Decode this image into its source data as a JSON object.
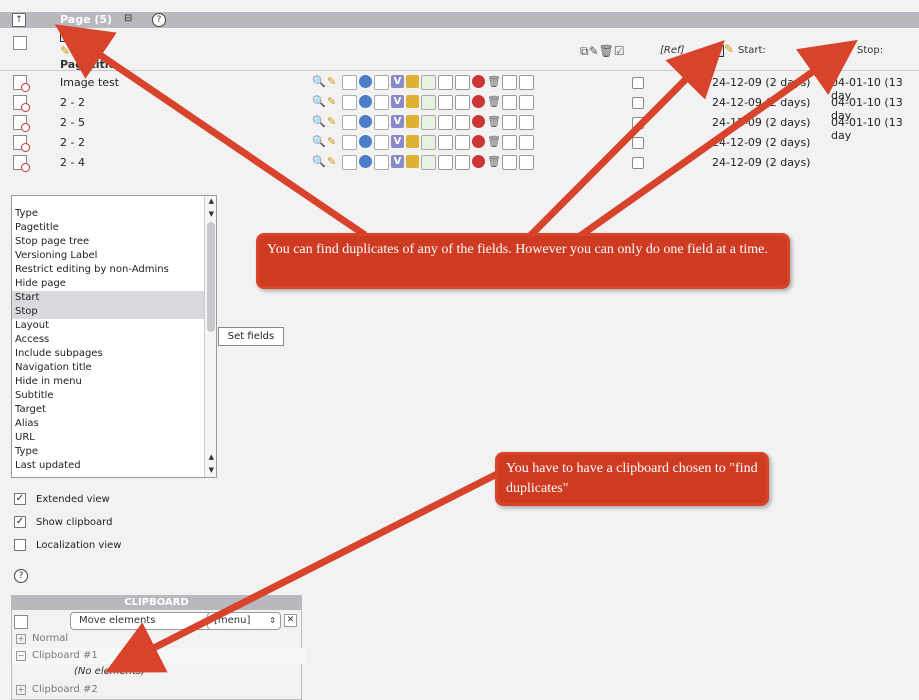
{
  "header": {
    "title": "Page (5)",
    "up_icon": "up-icon",
    "collapse_icon": "collapse-icon",
    "help": "?"
  },
  "columns": {
    "pagetitle": "Pagetitle",
    "ref": "[Ref]",
    "start": "Start:",
    "stop": "Stop:"
  },
  "rows": [
    {
      "title": "Image test",
      "start": "24-12-09 (2 days)",
      "stop": "04-01-10 (13 day"
    },
    {
      "title": "2 - 2",
      "start": "24-12-09 (2 days)",
      "stop": "04-01-10 (13 day"
    },
    {
      "title": "2 - 5",
      "start": "24-12-09 (2 days)",
      "stop": "04-01-10 (13 day"
    },
    {
      "title": "2 - 2",
      "start": "24-12-09 (2 days)",
      "stop": ""
    },
    {
      "title": "2 - 4",
      "start": "24-12-09 (2 days)",
      "stop": ""
    }
  ],
  "fields_list": [
    "Type",
    "Pagetitle",
    "Stop page tree",
    "Versioning Label",
    "Restrict editing by non-Admins",
    "Hide page",
    "Start",
    "Stop",
    "Layout",
    "Access",
    "Include subpages",
    "Navigation title",
    "Hide in menu",
    "Subtitle",
    "Target",
    "Alias",
    "URL",
    "Type",
    "Last updated"
  ],
  "selected_fields": [
    "Start",
    "Stop"
  ],
  "set_fields_button": "Set fields",
  "options": {
    "extended_view": {
      "label": "Extended view",
      "checked": true
    },
    "show_clipboard": {
      "label": "Show clipboard",
      "checked": true
    },
    "localization_view": {
      "label": "Localization view",
      "checked": false
    }
  },
  "clipboard": {
    "title": "CLIPBOARD",
    "move_select": "Move elements",
    "menu_select": "[menu]",
    "pads": [
      {
        "label": "Normal",
        "expanded": false
      },
      {
        "label": "Clipboard #1",
        "expanded": true
      },
      {
        "label": "Clipboard #2",
        "expanded": false
      }
    ],
    "no_elements": "(No elements)"
  },
  "callouts": {
    "top": "You can find duplicates of any of the fields.  However you can only do one field at a time.",
    "bottom": "You have to have a clipboard chosen to \"find duplicates\""
  },
  "colors": {
    "callout_bg": "#cf3a22",
    "header_bar": "#b8b8be"
  }
}
